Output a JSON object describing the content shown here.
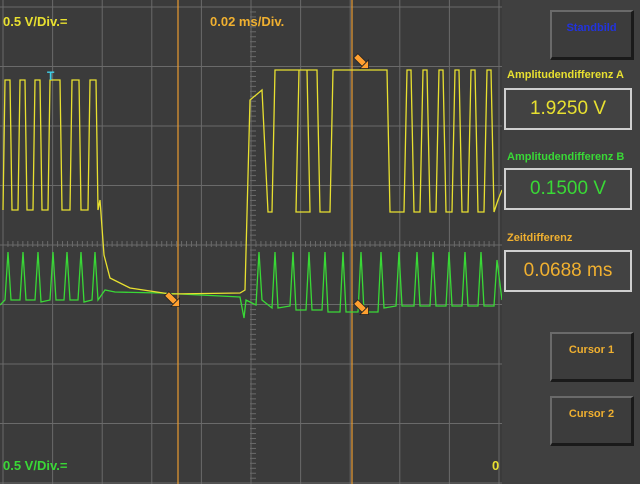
{
  "colors": {
    "channel_a": "#e8e030",
    "channel_b": "#39d836",
    "time": "#f0b030",
    "cursor": "#ffa030",
    "grid": "#6a6a6a",
    "blue_text": "#2233dd"
  },
  "scope": {
    "ch_a_scale": "0.5 V/Div.=",
    "time_scale": "0.02 ms/Div.",
    "ch_b_scale": "0.5 V/Div.=",
    "trigger_marker": "T",
    "zero_marker": "0"
  },
  "sidebar": {
    "standbild_label": "Standbild",
    "amp_a_label": "Amplitudendifferenz A",
    "amp_a_value": "1.9250 V",
    "amp_b_label": "Amplitudendifferenz B",
    "amp_b_value": "0.1500 V",
    "time_label": "Zeitdifferenz",
    "time_value": "0.0688 ms",
    "cursor1_label": "Cursor 1",
    "cursor2_label": "Cursor 2"
  }
}
